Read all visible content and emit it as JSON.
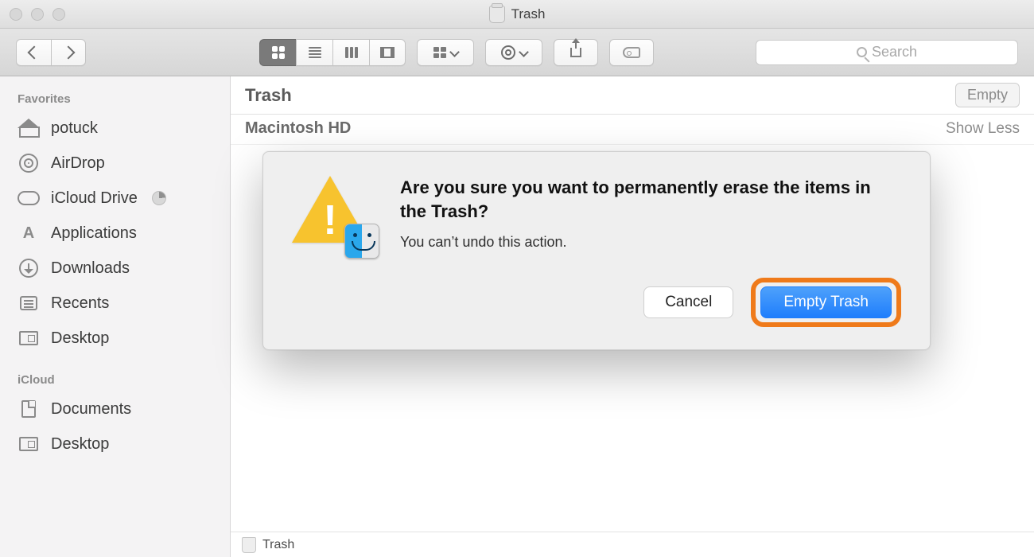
{
  "window": {
    "title": "Trash"
  },
  "toolbar": {
    "search_placeholder": "Search"
  },
  "sidebar": {
    "sections": [
      {
        "header": "Favorites",
        "items": [
          {
            "label": "potuck",
            "icon": "home"
          },
          {
            "label": "AirDrop",
            "icon": "airdrop"
          },
          {
            "label": "iCloud Drive",
            "icon": "cloud",
            "badge": true
          },
          {
            "label": "Applications",
            "icon": "apps"
          },
          {
            "label": "Downloads",
            "icon": "down"
          },
          {
            "label": "Recents",
            "icon": "recents"
          },
          {
            "label": "Desktop",
            "icon": "desktop"
          }
        ]
      },
      {
        "header": "iCloud",
        "items": [
          {
            "label": "Documents",
            "icon": "doc"
          },
          {
            "label": "Desktop",
            "icon": "desktop"
          }
        ]
      }
    ]
  },
  "main": {
    "title": "Trash",
    "empty_label": "Empty",
    "location": "Macintosh HD",
    "show_toggle": "Show Less",
    "pathbar": "Trash"
  },
  "dialog": {
    "title": "Are you sure you want to permanently erase the items in the Trash?",
    "message": "You can’t undo this action.",
    "cancel": "Cancel",
    "confirm": "Empty Trash"
  },
  "annotation": {
    "highlight_color": "#ef7a1a"
  }
}
